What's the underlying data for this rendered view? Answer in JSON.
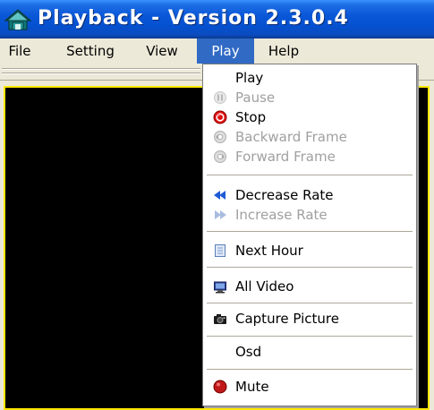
{
  "window": {
    "title": "Playback - Version 2.3.0.4"
  },
  "menubar": {
    "items": [
      {
        "label": "File"
      },
      {
        "label": "Setting"
      },
      {
        "label": "View"
      },
      {
        "label": "Play",
        "active": true
      },
      {
        "label": "Help"
      }
    ]
  },
  "play_menu": {
    "items": [
      {
        "label": "Play",
        "enabled": true,
        "icon": "none"
      },
      {
        "label": "Pause",
        "enabled": false,
        "icon": "pause-icon"
      },
      {
        "label": "Stop",
        "enabled": true,
        "icon": "stop-icon"
      },
      {
        "label": "Backward Frame",
        "enabled": false,
        "icon": "backward-frame-icon"
      },
      {
        "label": "Forward  Frame",
        "enabled": false,
        "icon": "forward-frame-icon"
      },
      {
        "label": "Decrease Rate",
        "enabled": true,
        "icon": "decrease-rate-icon"
      },
      {
        "label": "Increase Rate",
        "enabled": false,
        "icon": "increase-rate-icon"
      },
      {
        "label": "Next Hour",
        "enabled": true,
        "icon": "document-icon"
      },
      {
        "label": "All Video",
        "enabled": true,
        "icon": "monitor-icon"
      },
      {
        "label": "Capture Picture",
        "enabled": true,
        "icon": "camera-icon"
      },
      {
        "label": "Osd",
        "enabled": true,
        "icon": "none"
      },
      {
        "label": "Mute",
        "enabled": true,
        "icon": "mute-icon"
      }
    ]
  },
  "colors": {
    "menu_highlight": "#316ac5",
    "video_border": "#ffe800",
    "disabled_text": "#a0a0a0"
  }
}
